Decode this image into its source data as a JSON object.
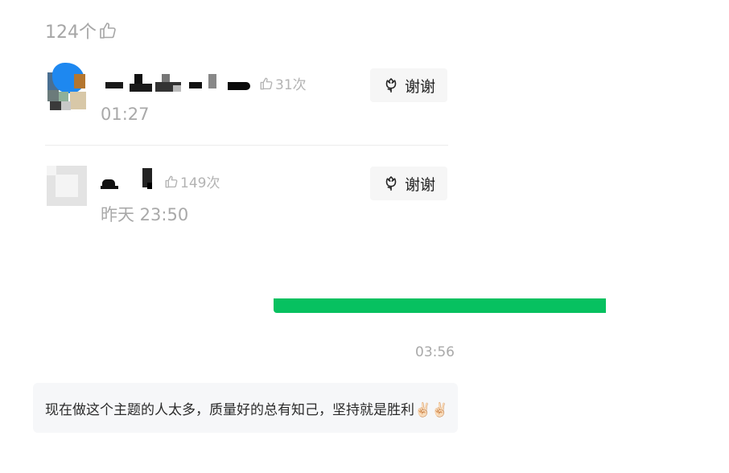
{
  "summary": {
    "like_count": "124个"
  },
  "comments": [
    {
      "likes": "31次",
      "time": "01:27",
      "thanks_label": "谢谢"
    },
    {
      "likes": "149次",
      "time": "昨天 23:50",
      "thanks_label": "谢谢"
    }
  ],
  "message": {
    "time": "03:56",
    "text": "现在做这个主题的人太多，质量好的总有知己，坚持就是胜利✌🏻✌🏻"
  },
  "icons": {
    "like": "thumbs-up-icon",
    "thanks": "flower-icon"
  },
  "colors": {
    "accent": "#07c160",
    "muted": "#a9a9a9",
    "button_bg": "#f6f6f6",
    "bubble_bg": "#f6f7f9"
  }
}
